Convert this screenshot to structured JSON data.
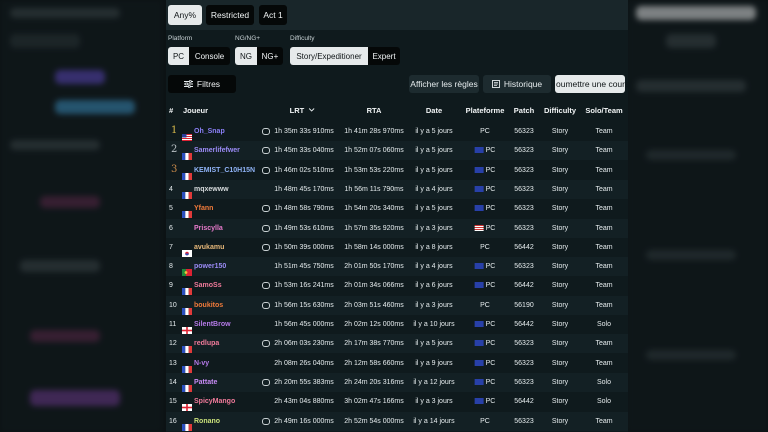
{
  "filters": {
    "category_tabs": [
      "Any%",
      "Restricted",
      "Act 1"
    ],
    "platform_label": "Platform",
    "platform_options": [
      "PC",
      "Console"
    ],
    "ngplus_label": "NG/NG+",
    "ngplus_options": [
      "NG",
      "NG+"
    ],
    "difficulty_label": "Difficulty",
    "difficulty_options": [
      "Story/Expeditioner",
      "Expert"
    ]
  },
  "toolbar": {
    "filters_button": "Filtres",
    "rules_button": "Afficher les règles",
    "history_button": "Historique",
    "submit_button": "oumettre une cours"
  },
  "table": {
    "headers": [
      "#",
      "Joueur",
      "LRT",
      "RTA",
      "Date",
      "Plateforme",
      "Patch",
      "Difficulty",
      "Solo/Team"
    ],
    "rows": [
      {
        "rank": "1",
        "player": "Oh_Snap",
        "flag": "us",
        "player_color": "#8a7ff5",
        "chat": true,
        "lrt": "1h 35m 33s 910ms",
        "rta": "1h 41m 28s 970ms",
        "date": "il y a 5 jours",
        "platform": "PC",
        "platform_flag": "",
        "patch": "56323",
        "difficulty": "Story",
        "team": "Team"
      },
      {
        "rank": "2",
        "player": "Samerlifefwer",
        "flag": "fr",
        "player_color": "#9b8bf6",
        "chat": true,
        "lrt": "1h 45m 33s 040ms",
        "rta": "1h 52m 07s 060ms",
        "date": "il y a 5 jours",
        "platform": "PC",
        "platform_flag": "eu",
        "patch": "56323",
        "difficulty": "Story",
        "team": "Team"
      },
      {
        "rank": "3",
        "player": "KEMIST_C10H15N",
        "flag": "fr",
        "player_color": "#8fb2f5",
        "chat": true,
        "lrt": "1h 46m 02s 510ms",
        "rta": "1h 53m 53s 220ms",
        "date": "il y a 5 jours",
        "platform": "PC",
        "platform_flag": "eu",
        "patch": "56323",
        "difficulty": "Story",
        "team": "Team"
      },
      {
        "rank": "4",
        "player": "mqxewww",
        "flag": "fr",
        "player_color": "#d6dadc",
        "chat": false,
        "lrt": "1h 48m 45s 170ms",
        "rta": "1h 56m 11s 790ms",
        "date": "il y a 4 jours",
        "platform": "PC",
        "platform_flag": "eu",
        "patch": "56323",
        "difficulty": "Story",
        "team": "Team"
      },
      {
        "rank": "5",
        "player": "Yfann",
        "flag": "fr",
        "player_color": "#f07a3a",
        "chat": true,
        "lrt": "1h 48m 58s 790ms",
        "rta": "1h 54m 20s 340ms",
        "date": "il y a 5 jours",
        "platform": "PC",
        "platform_flag": "eu",
        "patch": "56323",
        "difficulty": "Story",
        "team": "Team"
      },
      {
        "rank": "6",
        "player": "Priscylla",
        "flag": "",
        "player_color": "#e77acb",
        "chat": true,
        "lrt": "1h 49m 53s 610ms",
        "rta": "1h 57m 35s 920ms",
        "date": "il y a 3 jours",
        "platform": "PC",
        "platform_flag": "us",
        "patch": "56323",
        "difficulty": "Story",
        "team": "Team"
      },
      {
        "rank": "7",
        "player": "avukamu",
        "flag": "kr",
        "player_color": "#e7b87a",
        "chat": true,
        "lrt": "1h 50m 39s 000ms",
        "rta": "1h 58m 14s 000ms",
        "date": "il y a 8 jours",
        "platform": "PC",
        "platform_flag": "",
        "patch": "56442",
        "difficulty": "Story",
        "team": "Team"
      },
      {
        "rank": "8",
        "player": "power150",
        "flag": "pt",
        "player_color": "#9b8bf6",
        "chat": false,
        "lrt": "1h 51m 45s 750ms",
        "rta": "2h 01m 50s 170ms",
        "date": "il y a 4 jours",
        "platform": "PC",
        "platform_flag": "eu",
        "patch": "56323",
        "difficulty": "Story",
        "team": "Team"
      },
      {
        "rank": "9",
        "player": "SamoSs",
        "flag": "fr",
        "player_color": "#f07a9a",
        "chat": true,
        "lrt": "1h 53m 16s 241ms",
        "rta": "2h 01m 34s 066ms",
        "date": "il y a 6 jours",
        "platform": "PC",
        "platform_flag": "eu",
        "patch": "56442",
        "difficulty": "Story",
        "team": "Team"
      },
      {
        "rank": "10",
        "player": "boukitos",
        "flag": "fr",
        "player_color": "#f07a3a",
        "chat": true,
        "lrt": "1h 56m 15s 630ms",
        "rta": "2h 03m 51s 460ms",
        "date": "il y a 3 jours",
        "platform": "PC",
        "platform_flag": "",
        "patch": "56190",
        "difficulty": "Story",
        "team": "Team"
      },
      {
        "rank": "11",
        "player": "SilentBrow",
        "flag": "en",
        "player_color": "#b57ae8",
        "chat": false,
        "lrt": "1h 56m 45s 000ms",
        "rta": "2h 02m 12s 000ms",
        "date": "il y a 10 jours",
        "platform": "PC",
        "platform_flag": "eu",
        "patch": "56442",
        "difficulty": "Story",
        "team": "Solo"
      },
      {
        "rank": "12",
        "player": "redlupa",
        "flag": "fr",
        "player_color": "#f07a9a",
        "chat": true,
        "lrt": "2h 06m 03s 230ms",
        "rta": "2h 17m 38s 770ms",
        "date": "il y a 5 jours",
        "platform": "PC",
        "platform_flag": "eu",
        "patch": "56323",
        "difficulty": "Story",
        "team": "Team"
      },
      {
        "rank": "13",
        "player": "N-vy",
        "flag": "fr",
        "player_color": "#b57ae8",
        "chat": false,
        "lrt": "2h 08m 26s 040ms",
        "rta": "2h 12m 58s 660ms",
        "date": "il y a 9 jours",
        "platform": "PC",
        "platform_flag": "eu",
        "patch": "56323",
        "difficulty": "Story",
        "team": "Team"
      },
      {
        "rank": "14",
        "player": "Pattate",
        "flag": "fr",
        "player_color": "#c98bf6",
        "chat": true,
        "lrt": "2h 20m 55s 383ms",
        "rta": "2h 24m 20s 316ms",
        "date": "il y a 12 jours",
        "platform": "PC",
        "platform_flag": "eu",
        "patch": "56323",
        "difficulty": "Story",
        "team": "Solo"
      },
      {
        "rank": "15",
        "player": "SpicyMango",
        "flag": "en",
        "player_color": "#f07a9a",
        "chat": false,
        "lrt": "2h 43m 04s 880ms",
        "rta": "3h 02m 47s 166ms",
        "date": "il y a 3 jours",
        "platform": "PC",
        "platform_flag": "eu",
        "patch": "56442",
        "difficulty": "Story",
        "team": "Solo"
      },
      {
        "rank": "16",
        "player": "Ronano",
        "flag": "fr",
        "player_color": "#c9e07a",
        "chat": true,
        "lrt": "2h 49m 16s 000ms",
        "rta": "2h 52m 54s 000ms",
        "date": "il y a 14 jours",
        "platform": "PC",
        "platform_flag": "",
        "patch": "56323",
        "difficulty": "Story",
        "team": "Team"
      }
    ]
  },
  "colors": {
    "gold": "#d8b94a",
    "silver": "#b9c0c4",
    "bronze": "#c98a4a"
  }
}
